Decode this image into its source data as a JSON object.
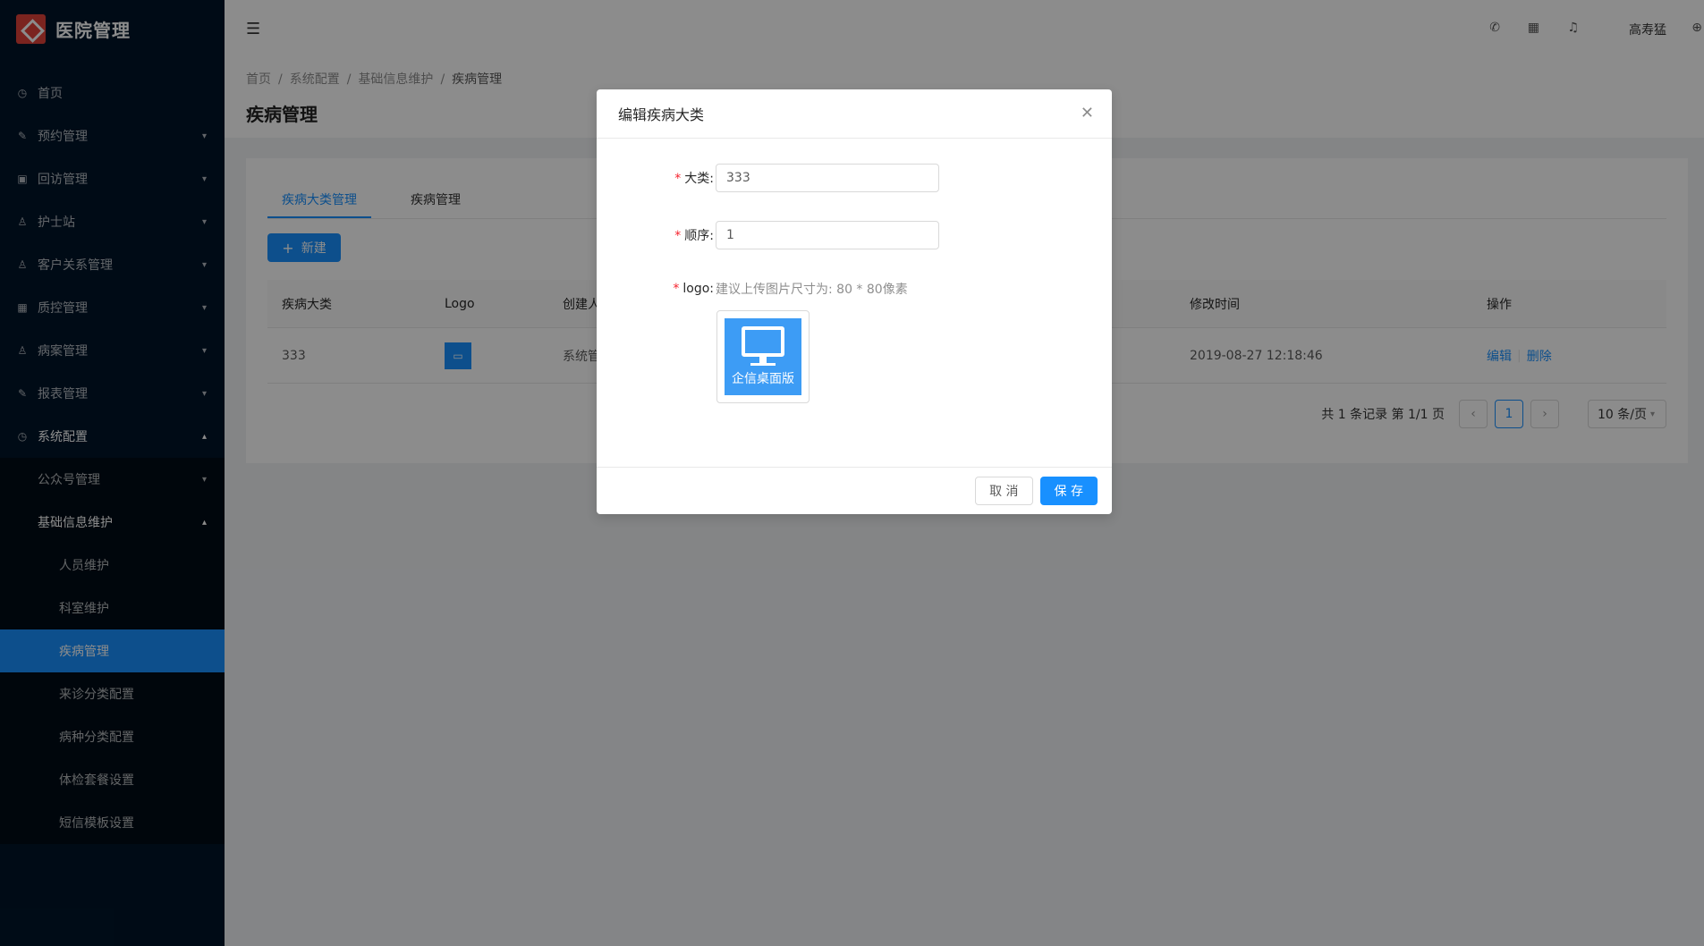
{
  "app": {
    "title": "医院管理"
  },
  "sidebar": {
    "items": [
      {
        "label": "首页",
        "icon": "dashboard-icon"
      },
      {
        "label": "预约管理",
        "icon": "edit-icon"
      },
      {
        "label": "回访管理",
        "icon": "lock-icon"
      },
      {
        "label": "护士站",
        "icon": "user-icon"
      },
      {
        "label": "客户关系管理",
        "icon": "user-icon"
      },
      {
        "label": "质控管理",
        "icon": "table-icon"
      },
      {
        "label": "病案管理",
        "icon": "user-icon"
      },
      {
        "label": "报表管理",
        "icon": "edit-icon"
      },
      {
        "label": "系统配置",
        "icon": "dashboard-icon"
      }
    ],
    "sub": {
      "wechat": "公众号管理",
      "basic": "基础信息维护"
    },
    "leaves": [
      "人员维护",
      "科室维护",
      "疾病管理",
      "来诊分类配置",
      "病种分类配置",
      "体检套餐设置",
      "短信模板设置"
    ]
  },
  "header": {
    "username": "高寿猛"
  },
  "breadcrumb": [
    "首页",
    "系统配置",
    "基础信息维护",
    "疾病管理"
  ],
  "page": {
    "title": "疾病管理"
  },
  "tabs": [
    "疾病大类管理",
    "疾病管理"
  ],
  "toolbar": {
    "new_label": "新建"
  },
  "table": {
    "headers": {
      "category": "疾病大类",
      "logo": "Logo",
      "creator": "创建人",
      "modified": "修改时间",
      "actions": "操作"
    },
    "rows": [
      {
        "category": "333",
        "creator": "系统管",
        "modified": "2019-08-27 12:18:46",
        "edit": "编辑",
        "delete": "删除"
      }
    ]
  },
  "pagination": {
    "summary": "共 1 条记录 第 1/1 页",
    "current": "1",
    "page_size": "10 条/页"
  },
  "modal": {
    "title": "编辑疾病大类",
    "fields": {
      "category": {
        "label": "大类:",
        "value": "333"
      },
      "order": {
        "label": "顺序:",
        "value": "1"
      },
      "logo": {
        "label": "logo:",
        "hint": "建议上传图片尺寸为: 80 * 80像素",
        "image_text": "企信桌面版"
      }
    },
    "cancel": "取 消",
    "save": "保 存"
  },
  "colors": {
    "primary": "#1890ff",
    "sidebar": "#001529",
    "required": "#f5222d"
  }
}
